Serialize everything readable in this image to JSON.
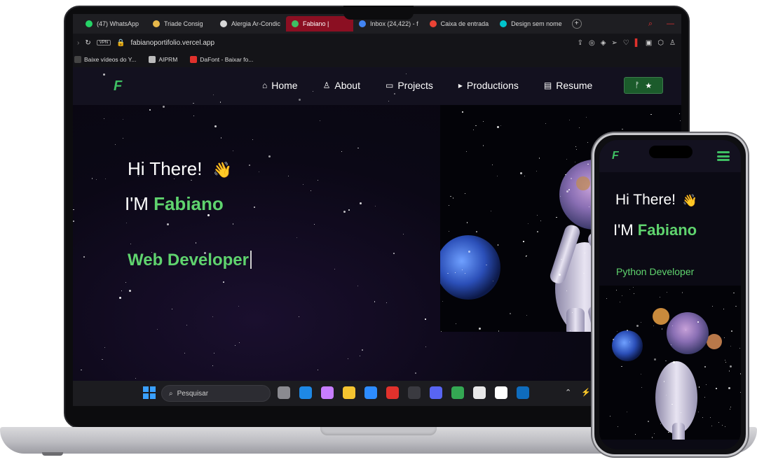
{
  "browser": {
    "tabs": [
      {
        "label": "(47) WhatsApp",
        "color": "#25d366",
        "active": false
      },
      {
        "label": "Triade Consig",
        "color": "#e7b84a",
        "active": false
      },
      {
        "label": "Alergia Ar-Condic",
        "color": "#d8d8d8",
        "active": false
      },
      {
        "label": "Fabiano |",
        "color": "#3fbf63",
        "active": true
      },
      {
        "label": "Inbox (24,422) - f",
        "color": "#4285f4",
        "active": false
      },
      {
        "label": "Caixa de entrada",
        "color": "#ea4335",
        "active": false
      },
      {
        "label": "Design sem nome",
        "color": "#00c4cc",
        "active": false
      }
    ],
    "new_tab": "+",
    "vpn_label": "VPN",
    "url": "fabianoportifolio.vercel.app",
    "bookmarks": [
      {
        "label": "Baixe vídeos do Y...",
        "color": "#444"
      },
      {
        "label": "AIPRM",
        "color": "#bbb"
      },
      {
        "label": "DaFont - Baixar fo...",
        "color": "#e0312c"
      }
    ]
  },
  "site": {
    "logo": "F",
    "nav": [
      {
        "label": "Home",
        "icon": "home-icon",
        "glyph": "⌂"
      },
      {
        "label": "About",
        "icon": "user-icon",
        "glyph": "♙"
      },
      {
        "label": "Projects",
        "icon": "monitor-icon",
        "glyph": "▭"
      },
      {
        "label": "Productions",
        "icon": "video-icon",
        "glyph": "▸"
      },
      {
        "label": "Resume",
        "icon": "document-icon",
        "glyph": "▤"
      }
    ],
    "star_button": {
      "fork_glyph": "ᚠ",
      "star_glyph": "★"
    },
    "greeting": "Hi There!",
    "wave_emoji": "👋",
    "name_prefix": "I'M",
    "name": "Fabiano",
    "role": "Web Developer"
  },
  "taskbar": {
    "search_placeholder": "Pesquisar",
    "apps": [
      {
        "name": "file-icon",
        "color": "#8a8a90"
      },
      {
        "name": "edge-icon",
        "color": "#1e88e5"
      },
      {
        "name": "copilot-icon",
        "color": "#c77dff"
      },
      {
        "name": "explorer-icon",
        "color": "#f4c430"
      },
      {
        "name": "store-icon",
        "color": "#2d8cff"
      },
      {
        "name": "opera-icon",
        "color": "#e0312c"
      },
      {
        "name": "terminal-icon",
        "color": "#3a3a40"
      },
      {
        "name": "discord-icon",
        "color": "#5865f2"
      },
      {
        "name": "chrome-icon",
        "color": "#34a853"
      },
      {
        "name": "notes-icon",
        "color": "#e8e8e8"
      },
      {
        "name": "capcut-icon",
        "color": "#ffffff"
      },
      {
        "name": "outlook-icon",
        "color": "#0f6cbd"
      }
    ],
    "tray": [
      "⌃",
      "⚡"
    ]
  },
  "phone": {
    "logo": "F",
    "greeting": "Hi There!",
    "wave_emoji": "👋",
    "name_prefix": "I'M",
    "name": "Fabiano",
    "role": "Python Developer"
  },
  "colors": {
    "accent": "#5fd36e",
    "nav_bg": "#13111f",
    "active_tab": "#8b0f22"
  }
}
